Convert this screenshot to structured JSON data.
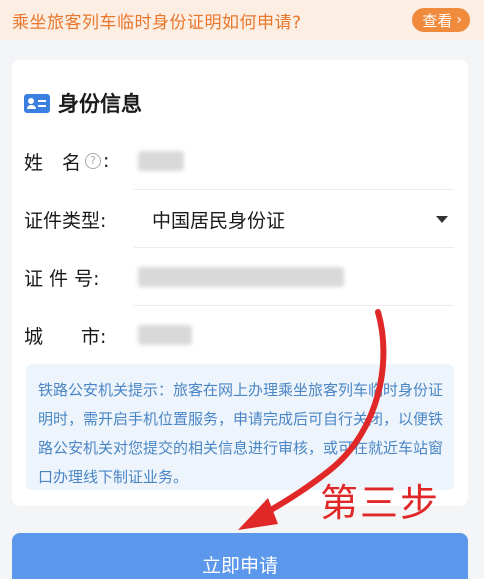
{
  "banner": {
    "text": "乘坐旅客列车临时身份证明如何申请?",
    "button_label": "查看",
    "button_chevron": "›"
  },
  "card": {
    "title": "身份信息",
    "icon": "id-card-icon",
    "fields": {
      "name_label": "姓　名",
      "name_help": "?",
      "name_colon": ":",
      "id_type_label": "证件类型:",
      "id_type_value": "中国居民身份证",
      "id_number_label": "证 件 号:",
      "city_label": "城　　市:"
    },
    "notice": "铁路公安机关提示：旅客在网上办理乘坐旅客列车临时身份证明时，需开启手机位置服务，申请完成后可自行关闭，以便铁路公安机关对您提交的相关信息进行审核，或可在就近车站窗口办理线下制证业务。"
  },
  "submit": {
    "label": "立即申请"
  },
  "annotation": {
    "text": "第三步",
    "color": "#e02828"
  },
  "colors": {
    "accent": "#f08a3c",
    "primary": "#5b97eb",
    "notice_text": "#4a86c5"
  }
}
